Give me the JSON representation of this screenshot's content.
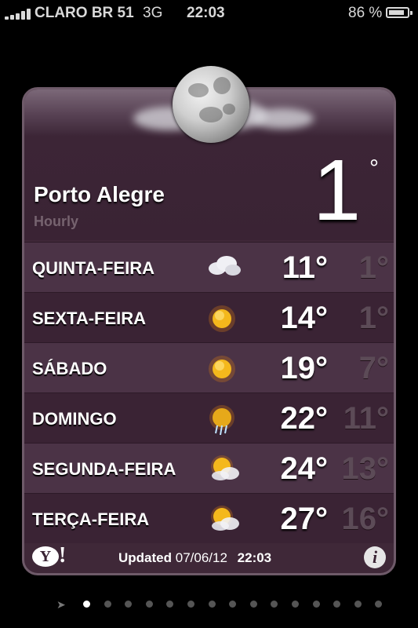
{
  "status_bar": {
    "carrier": "CLARO BR 51",
    "network": "3G",
    "time": "22:03",
    "battery_percent": "86 %",
    "battery_level": 0.86,
    "signal_bars": 5
  },
  "weather": {
    "city": "Porto Alegre",
    "mode": "Hourly",
    "current_temp": "1",
    "current_deg": "°",
    "forecast": [
      {
        "day": "QUINTA-FEIRA",
        "icon": "cloud-icon",
        "high": "11°",
        "low": "1°"
      },
      {
        "day": "SEXTA-FEIRA",
        "icon": "sun-icon",
        "high": "14°",
        "low": "1°"
      },
      {
        "day": "SÁBADO",
        "icon": "sun-icon",
        "high": "19°",
        "low": "7°"
      },
      {
        "day": "DOMINGO",
        "icon": "sun-rain-icon",
        "high": "22°",
        "low": "11°"
      },
      {
        "day": "SEGUNDA-FEIRA",
        "icon": "partly-cloudy-icon",
        "high": "24°",
        "low": "13°"
      },
      {
        "day": "TERÇA-FEIRA",
        "icon": "partly-cloudy-icon",
        "high": "27°",
        "low": "16°"
      }
    ],
    "footer": {
      "yahoo_logo": "Y!",
      "updated_label": "Updated",
      "updated_date": "07/06/12",
      "updated_time": "22:03",
      "info_label": "i"
    }
  },
  "pager": {
    "location_icon": "location-arrow-icon",
    "page_count": 15,
    "active_index": 0
  },
  "colors": {
    "card_bg": "#3f2838",
    "row_alt": "#4b3346",
    "low_temp": "#5c4b57",
    "header_muted": "#76636f"
  }
}
